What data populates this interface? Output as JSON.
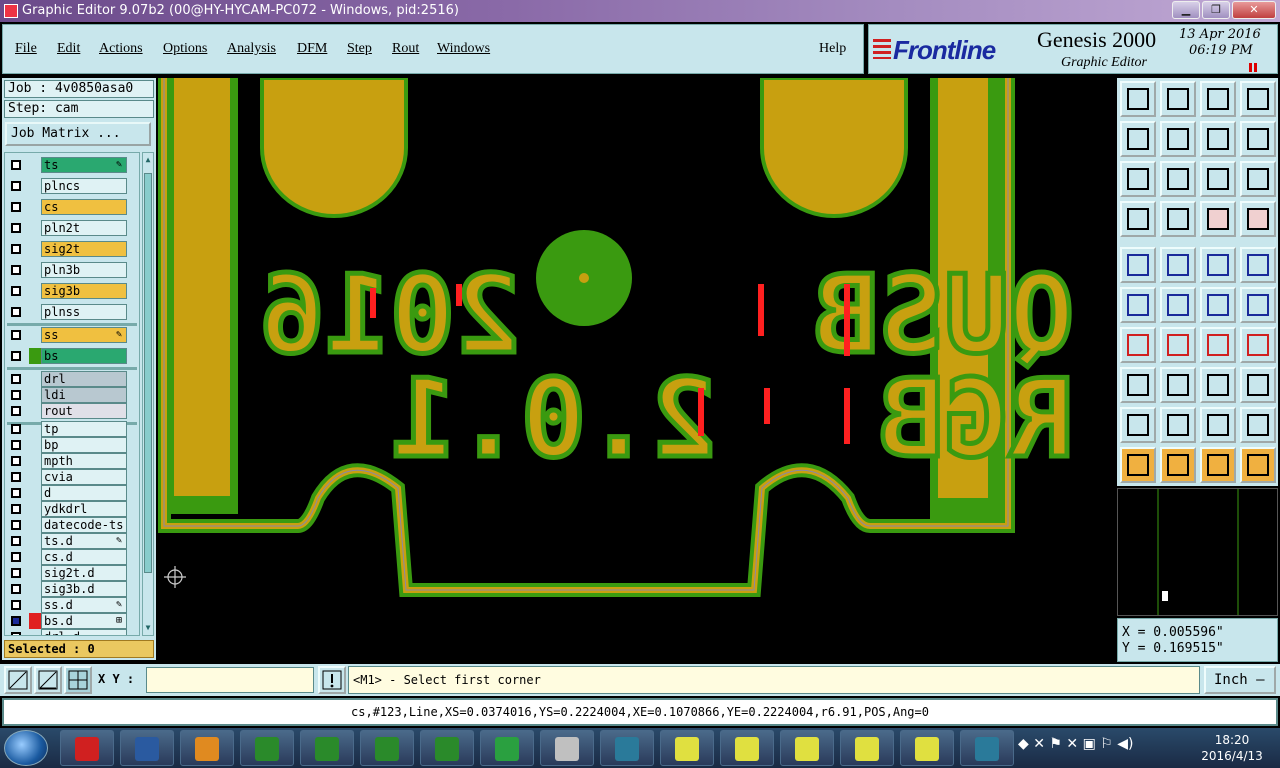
{
  "window": {
    "title": "Graphic Editor 9.07b2 (00@HY-HYCAM-PC072 - Windows, pid:2516)",
    "minimize_icon": "minimize-icon",
    "maximize_icon": "restore-icon",
    "close_icon": "close-icon"
  },
  "menu": {
    "file": "File",
    "edit": "Edit",
    "actions": "Actions",
    "options": "Options",
    "analysis": "Analysis",
    "dfm": "DFM",
    "step": "Step",
    "rout": "Rout",
    "windows": "Windows",
    "help": "Help"
  },
  "brand": {
    "logo": "Frontline",
    "product": "Genesis 2000",
    "subtitle": "Graphic Editor",
    "date": "13 Apr 2016",
    "time": "06:19 PM"
  },
  "job": {
    "job_line": "Job : 4v0850asa0",
    "step_line": "Step: cam",
    "matrix_button": "Job Matrix ..."
  },
  "layers": [
    {
      "name": "ts",
      "color": "#2aa870",
      "mark": "✎"
    },
    {
      "name": "plncs",
      "color": "#dff2f4",
      "mark": ""
    },
    {
      "name": "cs",
      "color": "#f0c040",
      "mark": ""
    },
    {
      "name": "pln2t",
      "color": "#dff2f4",
      "mark": ""
    },
    {
      "name": "sig2t",
      "color": "#f0c040",
      "mark": ""
    },
    {
      "name": "pln3b",
      "color": "#dff2f4",
      "mark": ""
    },
    {
      "name": "sig3b",
      "color": "#f0c040",
      "mark": ""
    },
    {
      "name": "plnss",
      "color": "#dff2f4",
      "mark": ""
    },
    {
      "name": "ss",
      "color": "#f0c040",
      "mark": "✎"
    },
    {
      "name": "bs",
      "color": "#2aa870",
      "mark": ""
    },
    {
      "name": "drl",
      "color": "#b8c8d0",
      "mark": ""
    },
    {
      "name": "ldi",
      "color": "#b8c8d0",
      "mark": ""
    },
    {
      "name": "rout",
      "color": "#e0e0e8",
      "mark": ""
    },
    {
      "name": "tp",
      "color": "#dff2f4",
      "mark": ""
    },
    {
      "name": "bp",
      "color": "#dff2f4",
      "mark": ""
    },
    {
      "name": "mpth",
      "color": "#dff2f4",
      "mark": ""
    },
    {
      "name": "cvia",
      "color": "#dff2f4",
      "mark": ""
    },
    {
      "name": "d",
      "color": "#dff2f4",
      "mark": ""
    },
    {
      "name": "ydkdrl",
      "color": "#dff2f4",
      "mark": ""
    },
    {
      "name": "datecode-ts",
      "color": "#dff2f4",
      "mark": ""
    },
    {
      "name": "ts.d",
      "color": "#dff2f4",
      "mark": "✎"
    },
    {
      "name": "cs.d",
      "color": "#dff2f4",
      "mark": ""
    },
    {
      "name": "sig2t.d",
      "color": "#dff2f4",
      "mark": ""
    },
    {
      "name": "sig3b.d",
      "color": "#dff2f4",
      "mark": ""
    },
    {
      "name": "ss.d",
      "color": "#dff2f4",
      "mark": "✎"
    },
    {
      "name": "bs.d",
      "color": "#dff2f4",
      "mark": "⊞"
    },
    {
      "name": "drl.d",
      "color": "#dff2f4",
      "mark": ""
    }
  ],
  "selected_text": "Selected : 0",
  "canvas": {
    "text_line1_left": "2016",
    "text_line1_right": "QUSB",
    "text_line2_left": "2.0.1",
    "text_line2_right": "RGB",
    "copper_color": "#c8a010",
    "mask_color": "#3a9a10",
    "highlight_color": "#ff2020"
  },
  "coords": {
    "x": "X = 0.005596\"",
    "y": "Y = 0.169515\""
  },
  "command": {
    "xy_label": "X Y :",
    "xy_value": "",
    "prompt": "<M1> - Select first corner",
    "units": "Inch —"
  },
  "status": "cs,#123,Line,XS=0.0374016,YS=0.2224004,XE=0.1070866,YE=0.2224004,r6.91,POS,Ang=0",
  "taskbar": {
    "time": "18:20",
    "date": "2016/4/13"
  }
}
